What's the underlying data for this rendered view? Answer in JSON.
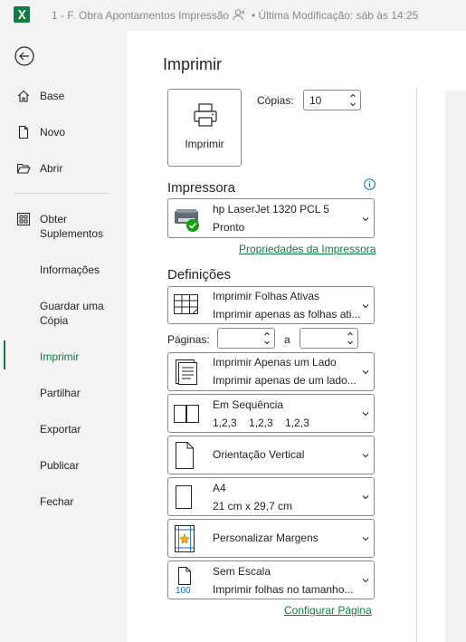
{
  "titlebar": {
    "doc_title": "1 - F. Obra Apontamentos Impressão",
    "separator": "•",
    "modified": "Última Modificação: sáb às 14:25",
    "accent": "#107c41"
  },
  "nav": {
    "back_icon": "back-arrow-icon",
    "items": [
      {
        "label": "Base",
        "icon": "home-icon"
      },
      {
        "label": "Novo",
        "icon": "new-document-icon"
      },
      {
        "label": "Abrir",
        "icon": "folder-open-icon"
      },
      {
        "label": "Obter Suplementos",
        "icon": "addins-grid-icon"
      },
      {
        "label": "Informações"
      },
      {
        "label": "Guardar uma Cópia"
      },
      {
        "label": "Imprimir",
        "active": true
      },
      {
        "label": "Partilhar"
      },
      {
        "label": "Exportar"
      },
      {
        "label": "Publicar"
      },
      {
        "label": "Fechar"
      }
    ]
  },
  "main": {
    "title": "Imprimir",
    "print_button": "Imprimir",
    "copies_label": "Cópias:",
    "copies_value": "10",
    "printer_heading": "Impressora",
    "printer_name": "hp LaserJet 1320 PCL 5",
    "printer_status": "Pronto",
    "printer_properties_link": "Propriedades da Impressora",
    "settings_heading": "Definições",
    "settings": [
      {
        "line1": "Imprimir Folhas Ativas",
        "line2": "Imprimir apenas as folhas ati..."
      },
      {
        "line1": "Imprimir Apenas um Lado",
        "line2": "Imprimir apenas de um lado..."
      },
      {
        "line1": "Em Sequência",
        "line2": "1,2,3    1,2,3    1,2,3"
      },
      {
        "line1": "Orientação Vertical"
      },
      {
        "line1": "A4",
        "line2": "21 cm x 29,7 cm"
      },
      {
        "line1": "Personalizar Margens"
      },
      {
        "line1": "Sem Escala",
        "line2": "Imprimir folhas no tamanho..."
      }
    ],
    "pages_label": "Páginas:",
    "pages_to": "a",
    "pages_from_value": "",
    "pages_to_value": "",
    "page_setup_link": "Configurar Página",
    "scale_icon_text": "100"
  }
}
